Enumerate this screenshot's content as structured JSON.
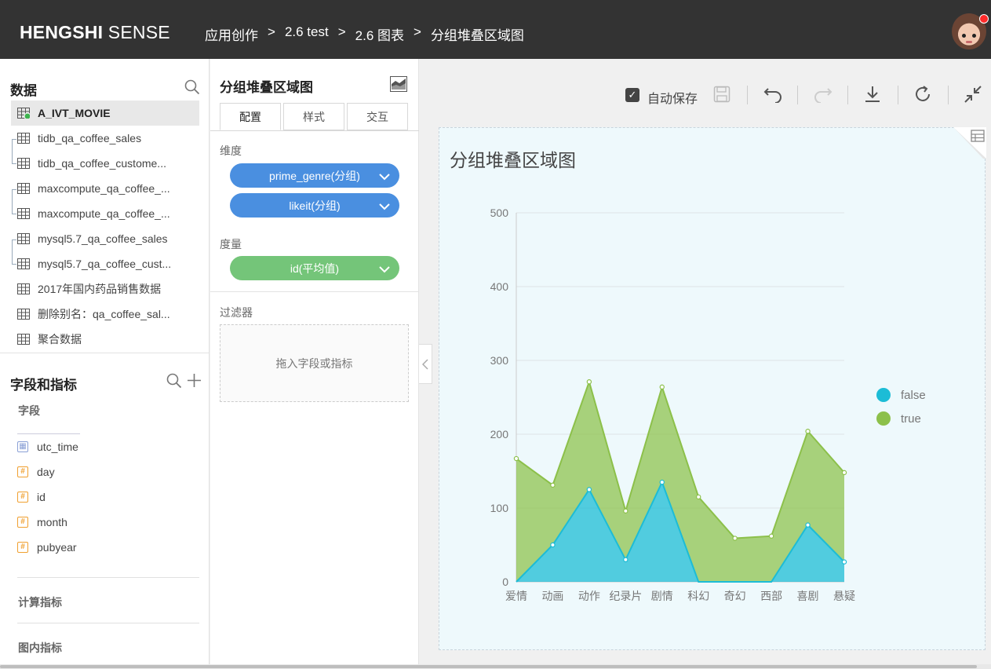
{
  "header": {
    "logo_bold": "HENGSHI",
    "logo_light": "SENSE",
    "breadcrumb": [
      "应用创作",
      "2.6 test",
      "2.6 图表",
      "分组堆叠区域图"
    ],
    "separator": ">"
  },
  "data_panel": {
    "title": "数据",
    "datasets": [
      {
        "label": "A_IVT_MOVIE",
        "active": true
      },
      {
        "label": "tidb_qa_coffee_sales"
      },
      {
        "label": "tidb_qa_coffee_custome..."
      },
      {
        "label": "maxcompute_qa_coffee_..."
      },
      {
        "label": "maxcompute_qa_coffee_..."
      },
      {
        "label": "mysql5.7_qa_coffee_sales"
      },
      {
        "label": "mysql5.7_qa_coffee_cust..."
      },
      {
        "label": "2017年国内药品销售数据"
      },
      {
        "label": "删除别名：qa_coffee_sal..."
      },
      {
        "label": "聚合数据"
      }
    ]
  },
  "fields_panel": {
    "title": "字段和指标",
    "fields_label": "字段",
    "fields": [
      {
        "label": "utc_time",
        "type": "date"
      },
      {
        "label": "day",
        "type": "number"
      },
      {
        "label": "id",
        "type": "number"
      },
      {
        "label": "month",
        "type": "number"
      },
      {
        "label": "pubyear",
        "type": "number"
      }
    ],
    "calc_label": "计算指标",
    "inchart_label": "图内指标"
  },
  "config_panel": {
    "title": "分组堆叠区域图",
    "tabs": [
      "配置",
      "样式",
      "交互"
    ],
    "dimension_label": "维度",
    "dimensions": [
      "prime_genre(分组)",
      "likeit(分组)"
    ],
    "measure_label": "度量",
    "measures": [
      "id(平均值)"
    ],
    "filter_label": "过滤器",
    "filter_placeholder": "拖入字段或指标"
  },
  "toolbar": {
    "autosave_label": "自动保存",
    "autosave_checked": true
  },
  "colors": {
    "header_bg": "#333333",
    "false_series": "#1cbcd6",
    "true_series": "#8cc04a",
    "dimension_pill": "#4a8fe0",
    "measure_pill": "#74c579"
  },
  "chart_data": {
    "type": "area",
    "stacked": true,
    "title": "分组堆叠区域图",
    "categories": [
      "爱情",
      "动画",
      "动作",
      "纪录片",
      "剧情",
      "科幻",
      "奇幻",
      "西部",
      "喜剧",
      "悬疑"
    ],
    "yticks": [
      "0",
      "100",
      "200",
      "300",
      "400",
      "500"
    ],
    "ylim": [
      0,
      500
    ],
    "series": [
      {
        "name": "false",
        "values": [
          0,
          50,
          125,
          30,
          135,
          0,
          0,
          0,
          77,
          27
        ]
      },
      {
        "name": "true",
        "values": [
          167,
          81,
          146,
          66,
          129,
          115,
          59,
          62,
          127,
          121
        ]
      }
    ],
    "legend_position": "right",
    "grid": true
  }
}
